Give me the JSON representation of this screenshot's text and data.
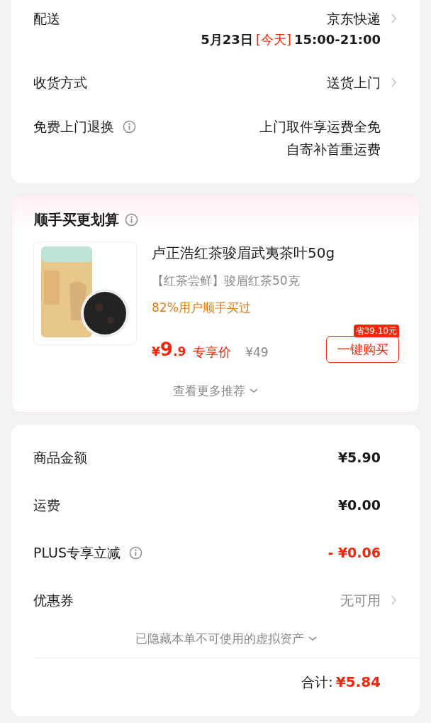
{
  "delivery": {
    "label": "配送",
    "value": "京东快递",
    "chevron": true,
    "date": "5月23日",
    "tag": "[今天]",
    "time": "15:00-21:00"
  },
  "rows": [
    {
      "label": "收货方式",
      "info": false,
      "lines": [
        "送货上门"
      ],
      "chevron": true
    },
    {
      "label": "免费上门退换",
      "info": true,
      "lines": [
        "上门取件享运费全免",
        "自寄补首重运费"
      ],
      "chevron": false
    }
  ],
  "recommend": {
    "title": "顺手买更划算",
    "product": {
      "kind": "picture",
      "name": "卢正浩红茶骏眉武夷茶叶50g",
      "subtitle": "【红茶尝鲜】骏眉红茶50克",
      "note": "82%用户顺手买过",
      "currency": "¥",
      "price_integer": "9",
      "price_decimal": ".9",
      "price_label": "专享价",
      "original_price": "¥49",
      "saving_badge": "省39.10元",
      "buy_button": "一键购买"
    },
    "more": "查看更多推荐"
  },
  "summary": {
    "rows": [
      {
        "label": "商品金额",
        "info": false,
        "value": "¥5.90",
        "kind": "amount",
        "chevron": false
      },
      {
        "label": "运费",
        "info": false,
        "value": "¥0.00",
        "kind": "amount",
        "chevron": false
      },
      {
        "label": "PLUS专享立减",
        "info": true,
        "value": "- ¥0.06",
        "kind": "discount",
        "chevron": false
      },
      {
        "label": "优惠券",
        "info": false,
        "value": "无可用",
        "kind": "muted",
        "chevron": true
      }
    ],
    "hidden_note": "已隐藏本单不可使用的虚拟资产",
    "total_label": "合计:",
    "total_value": "¥5.84"
  }
}
